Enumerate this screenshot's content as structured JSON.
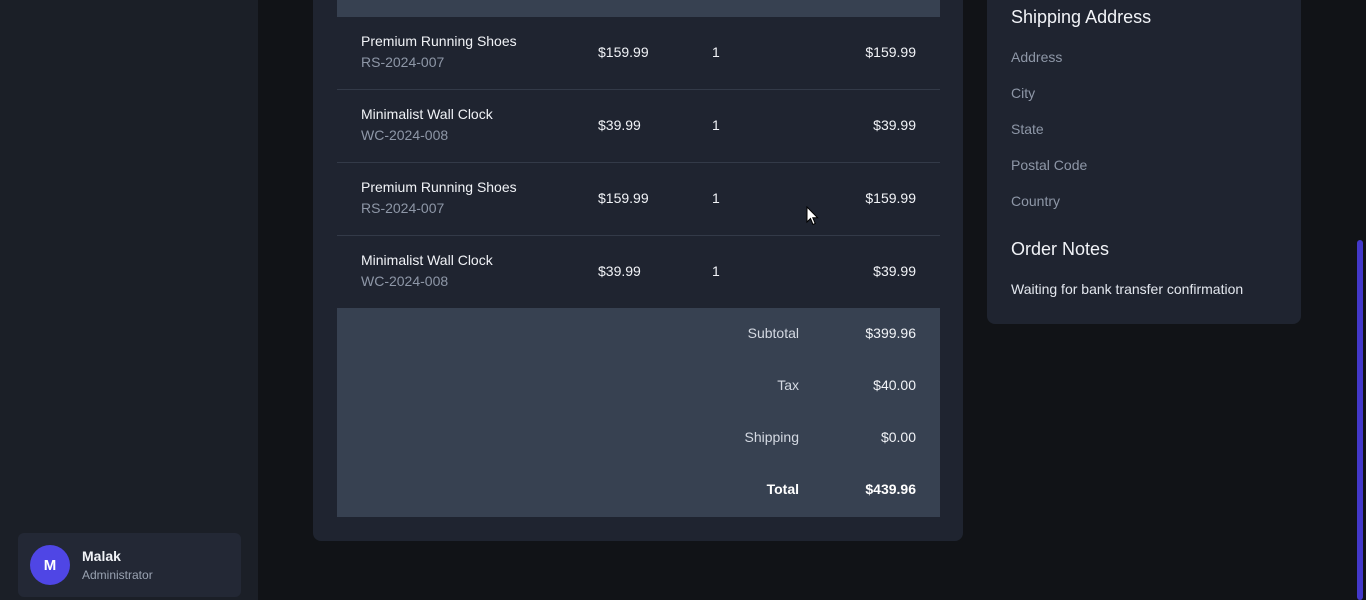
{
  "user": {
    "initial": "M",
    "name": "Malak",
    "role": "Administrator"
  },
  "order_items": [
    {
      "name": "Premium Running Shoes",
      "sku": "RS-2024-007",
      "price": "$159.99",
      "qty": "1",
      "total": "$159.99"
    },
    {
      "name": "Minimalist Wall Clock",
      "sku": "WC-2024-008",
      "price": "$39.99",
      "qty": "1",
      "total": "$39.99"
    },
    {
      "name": "Premium Running Shoes",
      "sku": "RS-2024-007",
      "price": "$159.99",
      "qty": "1",
      "total": "$159.99"
    },
    {
      "name": "Minimalist Wall Clock",
      "sku": "WC-2024-008",
      "price": "$39.99",
      "qty": "1",
      "total": "$39.99"
    }
  ],
  "totals": {
    "subtotal_label": "Subtotal",
    "subtotal": "$399.96",
    "tax_label": "Tax",
    "tax": "$40.00",
    "shipping_label": "Shipping",
    "shipping": "$0.00",
    "total_label": "Total",
    "total": "$439.96"
  },
  "shipping_address": {
    "title": "Shipping Address",
    "fields": [
      "Address",
      "City",
      "State",
      "Postal Code",
      "Country"
    ]
  },
  "order_notes": {
    "title": "Order Notes",
    "text": "Waiting for bank transfer confirmation"
  },
  "colors": {
    "accent": "#4f46e5",
    "background": "#111317",
    "card": "#1f2430",
    "table_header": "#374151"
  },
  "icons": {
    "cursor": "mouse-pointer-icon"
  }
}
